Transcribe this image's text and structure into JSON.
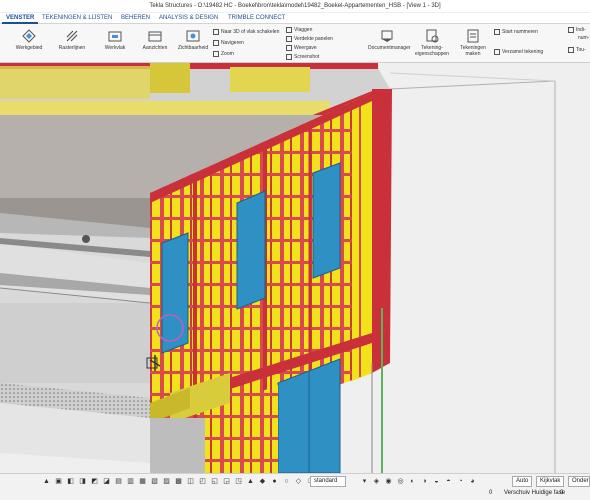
{
  "window": {
    "title": "Tekla Structures - O:\\19482 HC - Boekel\\bron\\tekla\\model\\19482_Boekel-Appartementen_HSB - [View 1 - 3D]"
  },
  "tabs": [
    "VENSTER",
    "TEKENINGEN & LIJSTEN",
    "BEHEREN",
    "ANALYSIS & DESIGN",
    "TRIMBLE CONNECT"
  ],
  "ribbon": {
    "large": [
      "Werkgebied",
      "Rasterlijnen",
      "Werkvlak",
      "Aanzichten",
      "Zichtbaarheid",
      "Documentmanager",
      "Tekening-eigenschappen",
      "Tekeningen maken"
    ],
    "view_small": [
      "Naar 3D of vlak schakelen",
      "Navigeren",
      "Zoom"
    ],
    "list_small": [
      "Vlaggen",
      "Verdekte panelen",
      "Weergave",
      "Screenshot"
    ],
    "right_small": [
      "Start nummeren",
      "Verzamel tekening",
      "Indi-",
      "num-",
      "Tou-"
    ]
  },
  "statusbar": {
    "phase_select": "standard",
    "snap_select": "Auto",
    "view_select": "Kijkvlak",
    "right_select": "Onder",
    "selection_count": "0",
    "count": "0",
    "phase_text": "Verschuiv Huidige fase"
  },
  "colors": {
    "structure_red": "#d94a4d",
    "insulation_yellow": "#f2e21b",
    "window_blue": "#2f90c4",
    "beam_red": "#c9303a"
  }
}
